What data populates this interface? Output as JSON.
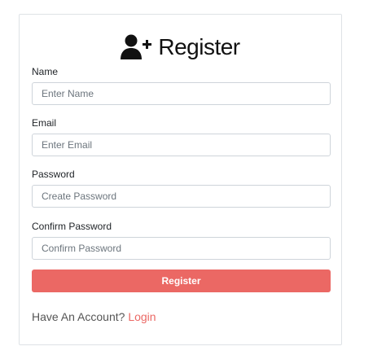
{
  "header": {
    "icon": "user-plus-icon",
    "title": "Register"
  },
  "form": {
    "name": {
      "label": "Name",
      "value": "",
      "placeholder": "Enter Name"
    },
    "email": {
      "label": "Email",
      "value": "",
      "placeholder": "Enter Email"
    },
    "password": {
      "label": "Password",
      "value": "",
      "placeholder": "Create Password"
    },
    "confirm_password": {
      "label": "Confirm Password",
      "value": "",
      "placeholder": "Confirm Password"
    },
    "submit_label": "Register"
  },
  "footer": {
    "prompt": "Have An Account?",
    "login_link": "Login"
  },
  "colors": {
    "accent": "#eb6864",
    "text": "#212529",
    "border": "#ced4da"
  }
}
